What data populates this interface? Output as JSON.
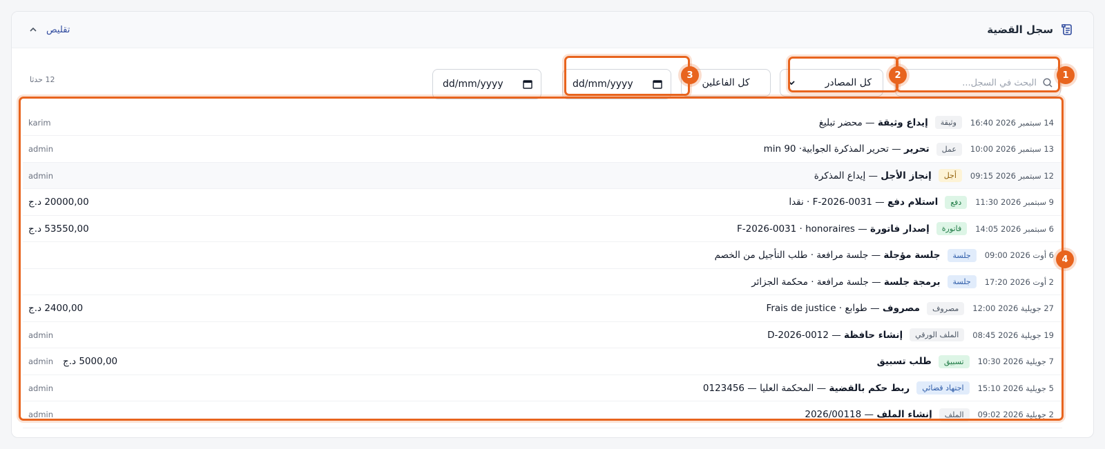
{
  "header": {
    "title": "سجل القضية",
    "title_icon": "scroll-icon",
    "collapse_label": "تقليص"
  },
  "toolbar": {
    "count": "12 حدثا",
    "search_placeholder": "البحث في السجل...",
    "source_select": "كل المصادر",
    "actor_filter": "كل الفاعلين",
    "date_from": "dd/mm/yyyy",
    "date_to": "dd/mm/yyyy"
  },
  "entries": [
    {
      "datetime": "14 سبتمبر 2026 16:40",
      "badge": "وثيقة",
      "title": "إيداع وثيقة",
      "detail": " — محضر تبليغ",
      "amount": "",
      "user": "karim"
    },
    {
      "datetime": "13 سبتمبر 2026 10:00",
      "badge": "عمل",
      "title": "تحرير",
      "detail": " — تحرير المذكرة الجوابية· 90 min",
      "amount": "",
      "user": "admin"
    },
    {
      "datetime": "12 سبتمبر 2026 09:15",
      "badge": "أجل",
      "title": "إنجاز الأجل",
      "detail": " — إيداع المذكرة",
      "amount": "",
      "user": "admin"
    },
    {
      "datetime": "9 سبتمبر 2026 11:30",
      "badge": "دفع",
      "title": "استلام دفع",
      "detail": " — F-2026-0031 · نقدا",
      "amount": "20000,00 د.ج",
      "user": ""
    },
    {
      "datetime": "6 سبتمبر 2026 14:05",
      "badge": "فاتورة",
      "title": "إصدار فاتورة",
      "detail": " — F-2026-0031 · honoraires",
      "amount": "53550,00 د.ج",
      "user": ""
    },
    {
      "datetime": "6 أوت 2026 09:00",
      "badge": "جلسة",
      "title": "جلسة مؤجلة",
      "detail": " — جلسة مرافعة · طلب التأجيل من الخصم",
      "amount": "",
      "user": ""
    },
    {
      "datetime": "2 أوت 2026 17:20",
      "badge": "جلسة",
      "title": "برمجة جلسة",
      "detail": " — جلسة مرافعة · محكمة الجزائر",
      "amount": "",
      "user": ""
    },
    {
      "datetime": "27 جويلية 2026 12:00",
      "badge": "مصروف",
      "title": "مصروف",
      "detail": " — طوابع · Frais de justice",
      "amount": "2400,00 د.ج",
      "user": ""
    },
    {
      "datetime": "19 جويلية 2026 08:45",
      "badge": "الملف الورقي",
      "title": "إنشاء حافظة",
      "detail": " — D-2026-0012",
      "amount": "",
      "user": "admin"
    },
    {
      "datetime": "7 جويلية 2026 10:30",
      "badge": "تسبيق",
      "title": "طلب تسبيق",
      "detail": "",
      "amount": "5000,00 د.ج",
      "user": "admin"
    },
    {
      "datetime": "5 جويلية 2026 15:10",
      "badge": "اجتهاد قضائي",
      "title": "ربط حكم بالقضية",
      "detail": " — المحكمة العليا — 0123456",
      "amount": "",
      "user": "admin"
    },
    {
      "datetime": "2 جويلية 2026 09:02",
      "badge": "الملف",
      "title": "إنشاء الملف",
      "detail": " — 2026/00118",
      "amount": "",
      "user": "admin"
    }
  ],
  "annotations": [
    "1",
    "2",
    "3",
    "4"
  ],
  "colors": {
    "accent": "#e8641e",
    "link": "#2f4a9e"
  }
}
